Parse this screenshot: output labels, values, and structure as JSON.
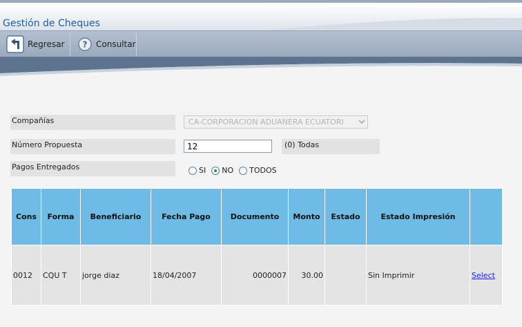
{
  "page": {
    "title": "Gestión de Cheques"
  },
  "toolbar": {
    "back_label": "Regresar",
    "query_label": "Consultar"
  },
  "form": {
    "company_label": "Compañías",
    "company_value": "CA-CORPORACION ADUANERA ECUATORI",
    "proposal_label": "Número Propuesta",
    "proposal_value": "12",
    "proposal_hint": "(0) Todas",
    "delivered_label": "Pagos Entregados",
    "options": [
      "SI",
      "NO",
      "TODOS"
    ],
    "selected_option": "NO"
  },
  "table": {
    "headers": [
      "Cons",
      "Forma",
      "Beneficiario",
      "Fecha Pago",
      "Documento",
      "Monto",
      "Estado",
      "Estado Impresión",
      ""
    ],
    "rows": [
      {
        "cons": "0012",
        "forma": "CQU T",
        "beneficiario": "jorge diaz",
        "fecha": "18/04/2007",
        "documento": "0000007",
        "monto": "30.00",
        "estado": "",
        "estado_impresion": "Sin Imprimir",
        "action": "Select"
      }
    ]
  },
  "colors": {
    "header_bg": "#6ebbe6",
    "title": "#1f5fa6",
    "toolbar": "#a8b6c8"
  },
  "icons": {
    "back": "back-arrow-icon",
    "query": "help-icon"
  }
}
